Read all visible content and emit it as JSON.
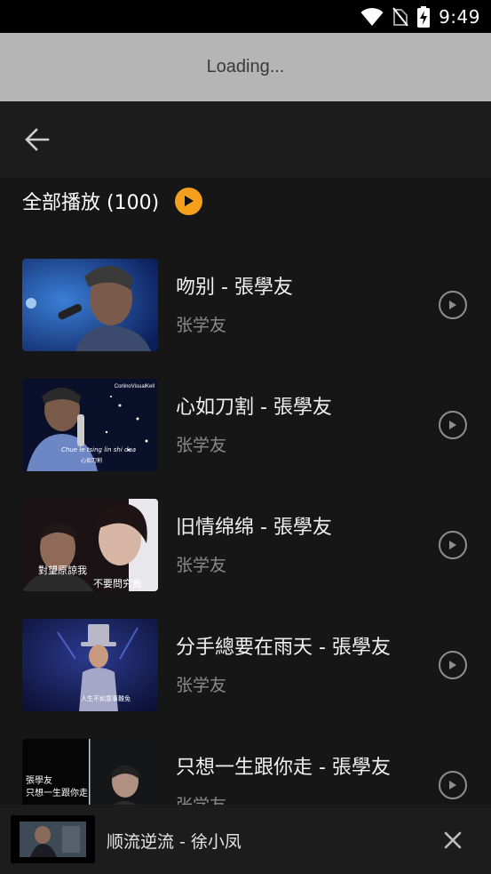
{
  "status_bar": {
    "time": "9:49",
    "icons": [
      "wifi-icon",
      "no-sim-icon",
      "battery-charging-icon"
    ]
  },
  "loading_banner": {
    "text": "Loading..."
  },
  "header": {
    "back_icon": "arrow-left-icon"
  },
  "play_all": {
    "label": "全部播放 (100)",
    "icon": "play-circle-icon",
    "accent_color": "#f5a01d"
  },
  "songs": [
    {
      "title": "吻别 - 張學友",
      "artist": "张学友"
    },
    {
      "title": "心如刀割 - 張學友",
      "artist": "张学友",
      "thumb_caption_tag": "CorlinoVisualKell",
      "thumb_caption_1": "Chue le tsing lin shi daa",
      "thumb_caption_2": "心如刀割"
    },
    {
      "title": "旧情绵绵 - 張學友",
      "artist": "张学友",
      "thumb_caption_1": "對望原諒我",
      "thumb_caption_2": "不要問究竟"
    },
    {
      "title": "分手總要在雨天 - 張學友",
      "artist": "张学友",
      "thumb_caption_1": "人生不如意事難免"
    },
    {
      "title": "只想一生跟你走 - 張學友",
      "artist": "张学友",
      "thumb_caption_1": "張學友",
      "thumb_caption_2": "只想一生跟你走"
    }
  ],
  "mini_player": {
    "title": "顺流逆流 - 徐小凤",
    "close_icon": "close-icon"
  }
}
